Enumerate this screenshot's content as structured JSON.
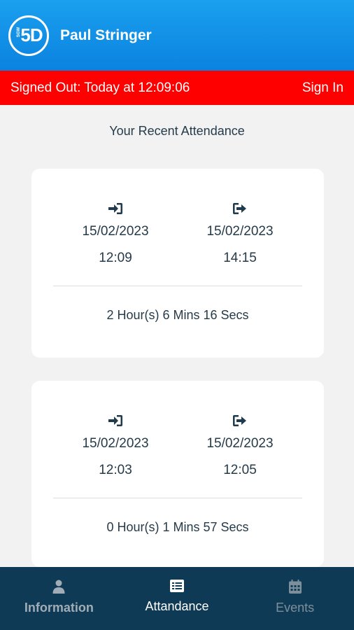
{
  "header": {
    "logo_main": "5D",
    "logo_small": "SGW",
    "user_name": "Paul Stringer"
  },
  "status": {
    "text": "Signed Out: Today at 12:09:06",
    "action_label": "Sign In"
  },
  "attendance": {
    "title": "Your Recent Attendance",
    "records": [
      {
        "in_date": "15/02/2023",
        "in_time": "12:09",
        "out_date": "15/02/2023",
        "out_time": "14:15",
        "duration": "2 Hour(s) 6 Mins 16 Secs"
      },
      {
        "in_date": "15/02/2023",
        "in_time": "12:03",
        "out_date": "15/02/2023",
        "out_time": "12:05",
        "duration": "0 Hour(s) 1 Mins 57 Secs"
      }
    ]
  },
  "tabs": [
    {
      "label": "Information",
      "icon": "user-icon"
    },
    {
      "label": "Attandance",
      "icon": "list-icon",
      "active": true
    },
    {
      "label": "Events",
      "icon": "calendar-icon"
    }
  ],
  "colors": {
    "header": "#0b82e0",
    "status_bar": "#fe0000",
    "tab_bar": "#0f3a55"
  }
}
